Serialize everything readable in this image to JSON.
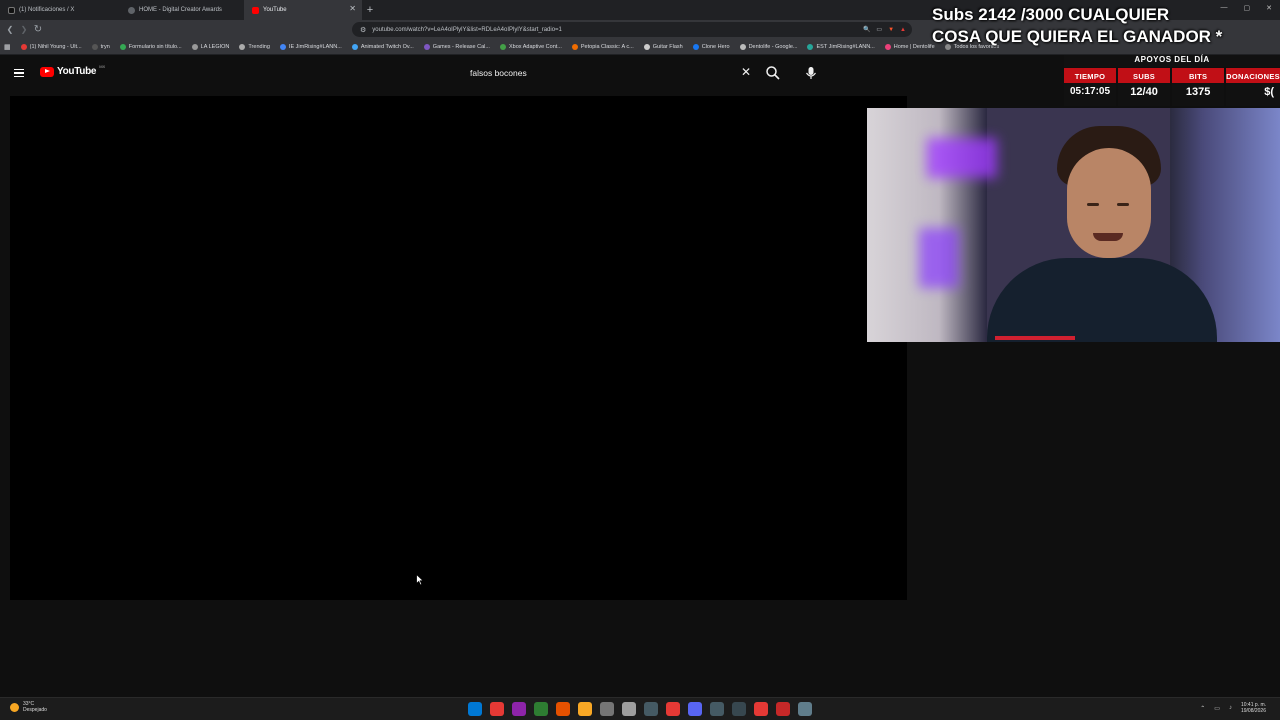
{
  "browser": {
    "tabs": [
      {
        "label": "(1) Notificaciones / X",
        "active": false,
        "favicon_color": "#000000"
      },
      {
        "label": "HOME - Digital Creator Awards",
        "active": false,
        "favicon_color": "#5f6368"
      },
      {
        "label": "YouTube",
        "active": true,
        "favicon_color": "#ff0000"
      }
    ],
    "new_tab": "+",
    "url": "youtube.com/watch?v=LeA4oIPlylY&list=RDLeA4oIPlylY&start_radio=1",
    "bookmarks": [
      {
        "label": "(1) Nihil Young - Ult...",
        "color": "#e53935"
      },
      {
        "label": "tryn",
        "color": "#555555"
      },
      {
        "label": "Formulario sin título...",
        "color": "#34a853"
      },
      {
        "label": "LA LEGION",
        "color": "#999999"
      },
      {
        "label": "Trending",
        "color": "#aaaaaa"
      },
      {
        "label": "IE JimRising#LANN...",
        "color": "#4285f4"
      },
      {
        "label": "Animated Twitch Ov...",
        "color": "#42a5f5"
      },
      {
        "label": "Games - Release Cal...",
        "color": "#7e57c2"
      },
      {
        "label": "Xbox Adaptive Cont...",
        "color": "#43a047"
      },
      {
        "label": "Petopia Classic: A c...",
        "color": "#ef6c00"
      },
      {
        "label": "Guitar Flash",
        "color": "#cccccc"
      },
      {
        "label": "Clone Hero",
        "color": "#1877f2"
      },
      {
        "label": "Dentolife - Google...",
        "color": "#bbbbbb"
      },
      {
        "label": "EST JimRising#LANN...",
        "color": "#26a69a"
      },
      {
        "label": "Home | Dentolife",
        "color": "#ec407a"
      },
      {
        "label": "Todos los favoritos",
        "color": "#888888"
      }
    ]
  },
  "youtube": {
    "logo_text": "YouTube",
    "region": "MX",
    "search_query": "falsos bocones"
  },
  "overlay": {
    "title_line1": "Subs 2142 /3000 CUALQUIER",
    "title_line2": "COSA QUE QUIERA EL GANADOR *",
    "support_label": "APOYOS DEL DÍA",
    "stats": [
      {
        "label": "TIEMPO",
        "value": "05:17:05"
      },
      {
        "label": "SUBS",
        "value": "12/40"
      },
      {
        "label": "BITS",
        "value": "1375"
      },
      {
        "label": "DONACIONES",
        "value": "$("
      }
    ]
  },
  "taskbar": {
    "temperature": "33°C",
    "weather": "Despejado",
    "time": "10:41 p. m.",
    "date": "19/08/2026",
    "icon_colors": [
      "#0078d4",
      "#e53935",
      "#8e24aa",
      "#2e7d32",
      "#e65100",
      "#f9a825",
      "#757575",
      "#9e9e9e",
      "#455a64",
      "#e53935",
      "#5865f2",
      "#455a64",
      "#37474f",
      "#e53935",
      "#c62828",
      "#607d8b"
    ]
  }
}
